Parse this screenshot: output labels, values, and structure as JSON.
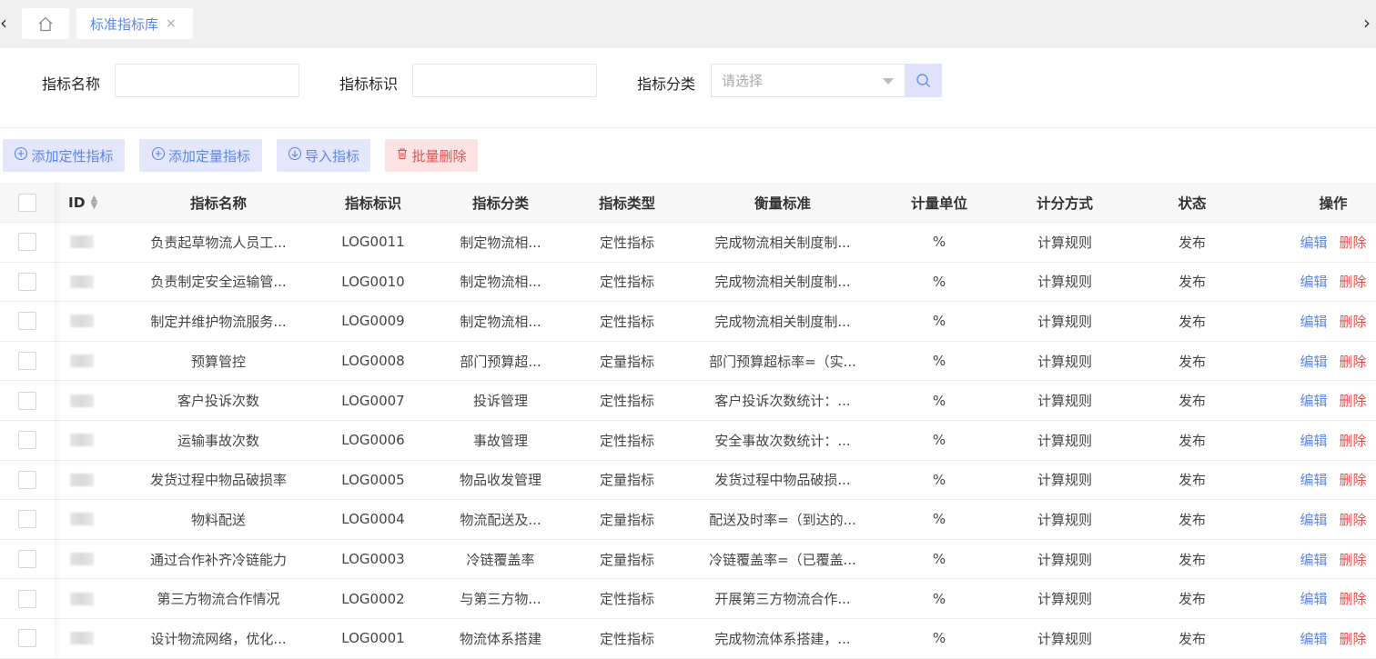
{
  "tabs": {
    "nav_left": "‹",
    "nav_right": "›",
    "active_label": "标准指标库",
    "close_glyph": "×"
  },
  "search": {
    "name_label": "指标名称",
    "name_value": "",
    "code_label": "指标标识",
    "code_value": "",
    "category_label": "指标分类",
    "category_placeholder": "请选择"
  },
  "toolbar": {
    "add_qualitative": "添加定性指标",
    "add_quantitative": "添加定量指标",
    "import": "导入指标",
    "batch_delete": "批量删除"
  },
  "table": {
    "headers": {
      "id": "ID",
      "name": "指标名称",
      "code": "指标标识",
      "category": "指标分类",
      "type": "指标类型",
      "standard": "衡量标准",
      "unit": "计量单位",
      "scoring": "计分方式",
      "status": "状态",
      "actions": "操作"
    },
    "edit_label": "编辑",
    "delete_label": "删除",
    "rows": [
      {
        "name": "负责起草物流人员工...",
        "code": "LOG0011",
        "category": "制定物流相...",
        "type": "定性指标",
        "standard": "完成物流相关制度制...",
        "unit": "%",
        "scoring": "计算规则",
        "status": "发布"
      },
      {
        "name": "负责制定安全运输管...",
        "code": "LOG0010",
        "category": "制定物流相...",
        "type": "定性指标",
        "standard": "完成物流相关制度制...",
        "unit": "%",
        "scoring": "计算规则",
        "status": "发布"
      },
      {
        "name": "制定并维护物流服务...",
        "code": "LOG0009",
        "category": "制定物流相...",
        "type": "定性指标",
        "standard": "完成物流相关制度制...",
        "unit": "%",
        "scoring": "计算规则",
        "status": "发布"
      },
      {
        "name": "预算管控",
        "code": "LOG0008",
        "category": "部门预算超...",
        "type": "定量指标",
        "standard": "部门预算超标率=（实...",
        "unit": "%",
        "scoring": "计算规则",
        "status": "发布"
      },
      {
        "name": "客户投诉次数",
        "code": "LOG0007",
        "category": "投诉管理",
        "type": "定性指标",
        "standard": "客户投诉次数统计：...",
        "unit": "%",
        "scoring": "计算规则",
        "status": "发布"
      },
      {
        "name": "运输事故次数",
        "code": "LOG0006",
        "category": "事故管理",
        "type": "定性指标",
        "standard": "安全事故次数统计：...",
        "unit": "%",
        "scoring": "计算规则",
        "status": "发布"
      },
      {
        "name": "发货过程中物品破损率",
        "code": "LOG0005",
        "category": "物品收发管理",
        "type": "定量指标",
        "standard": "发货过程中物品破损...",
        "unit": "%",
        "scoring": "计算规则",
        "status": "发布"
      },
      {
        "name": "物料配送",
        "code": "LOG0004",
        "category": "物流配送及...",
        "type": "定量指标",
        "standard": "配送及时率=（到达的...",
        "unit": "%",
        "scoring": "计算规则",
        "status": "发布"
      },
      {
        "name": "通过合作补齐冷链能力",
        "code": "LOG0003",
        "category": "冷链覆盖率",
        "type": "定量指标",
        "standard": "冷链覆盖率=（已覆盖...",
        "unit": "%",
        "scoring": "计算规则",
        "status": "发布"
      },
      {
        "name": "第三方物流合作情况",
        "code": "LOG0002",
        "category": "与第三方物...",
        "type": "定性指标",
        "standard": "开展第三方物流合作...",
        "unit": "%",
        "scoring": "计算规则",
        "status": "发布"
      },
      {
        "name": "设计物流网络，优化...",
        "code": "LOG0001",
        "category": "物流体系搭建",
        "type": "定性指标",
        "standard": "完成物流体系搭建，...",
        "unit": "%",
        "scoring": "计算规则",
        "status": "发布"
      }
    ]
  },
  "colors": {
    "accent": "#5b86e5",
    "danger": "#e4504d",
    "accent_bg": "#e4e7fb",
    "danger_bg": "#fbe3e3"
  }
}
